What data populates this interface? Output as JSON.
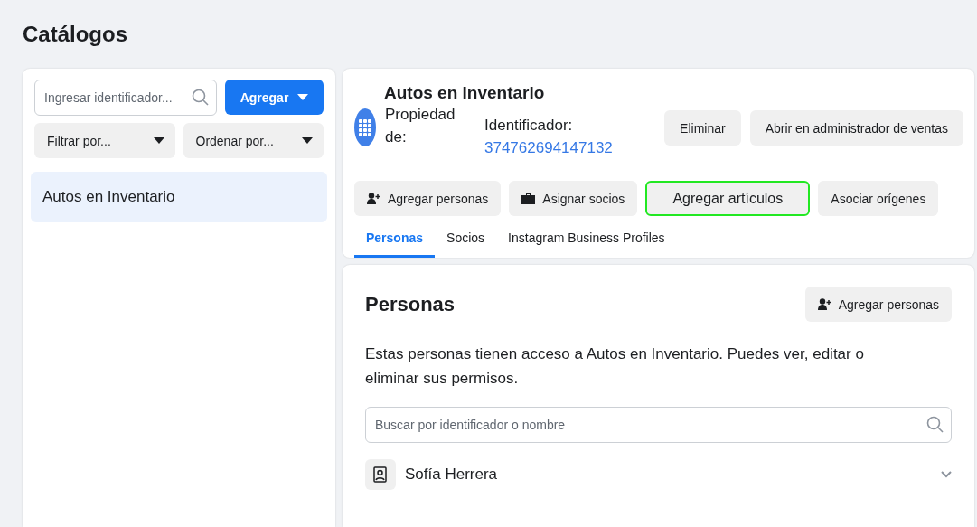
{
  "page_title": "Catálogos",
  "sidebar": {
    "search": {
      "placeholder": "Ingresar identificador..."
    },
    "add_button": "Agregar",
    "filters": [
      "Filtrar por...",
      "Ordenar por..."
    ],
    "items": [
      {
        "label": "Autos en Inventario",
        "selected": true
      }
    ]
  },
  "catalog": {
    "name": "Autos en Inventario",
    "owner_label": "Propiedad de:",
    "id_label": "Identificador:",
    "id_value": "374762694147132",
    "header_buttons": [
      "Eliminar",
      "Abrir en administrador de ventas"
    ],
    "actions": [
      {
        "label": "Agregar personas",
        "kind": "person",
        "highlighted": false
      },
      {
        "label": "Asignar socios",
        "kind": "partner",
        "highlighted": false
      },
      {
        "label": "Agregar artículos",
        "kind": "plain",
        "highlighted": true
      },
      {
        "label": "Asociar orígenes",
        "kind": "plain",
        "highlighted": false
      }
    ],
    "tabs": [
      {
        "label": "Personas",
        "selected": true
      },
      {
        "label": "Socios",
        "selected": false
      },
      {
        "label": "Instagram Business Profiles",
        "selected": false
      }
    ]
  },
  "people": {
    "title": "Personas",
    "add_button": "Agregar personas",
    "description": "Estas personas tienen acceso a Autos en Inventario. Puedes ver, editar o eliminar sus permisos.",
    "search": {
      "placeholder": "Buscar por identificador o nombre"
    },
    "rows": [
      {
        "name": "Sofía Herrera"
      }
    ]
  }
}
